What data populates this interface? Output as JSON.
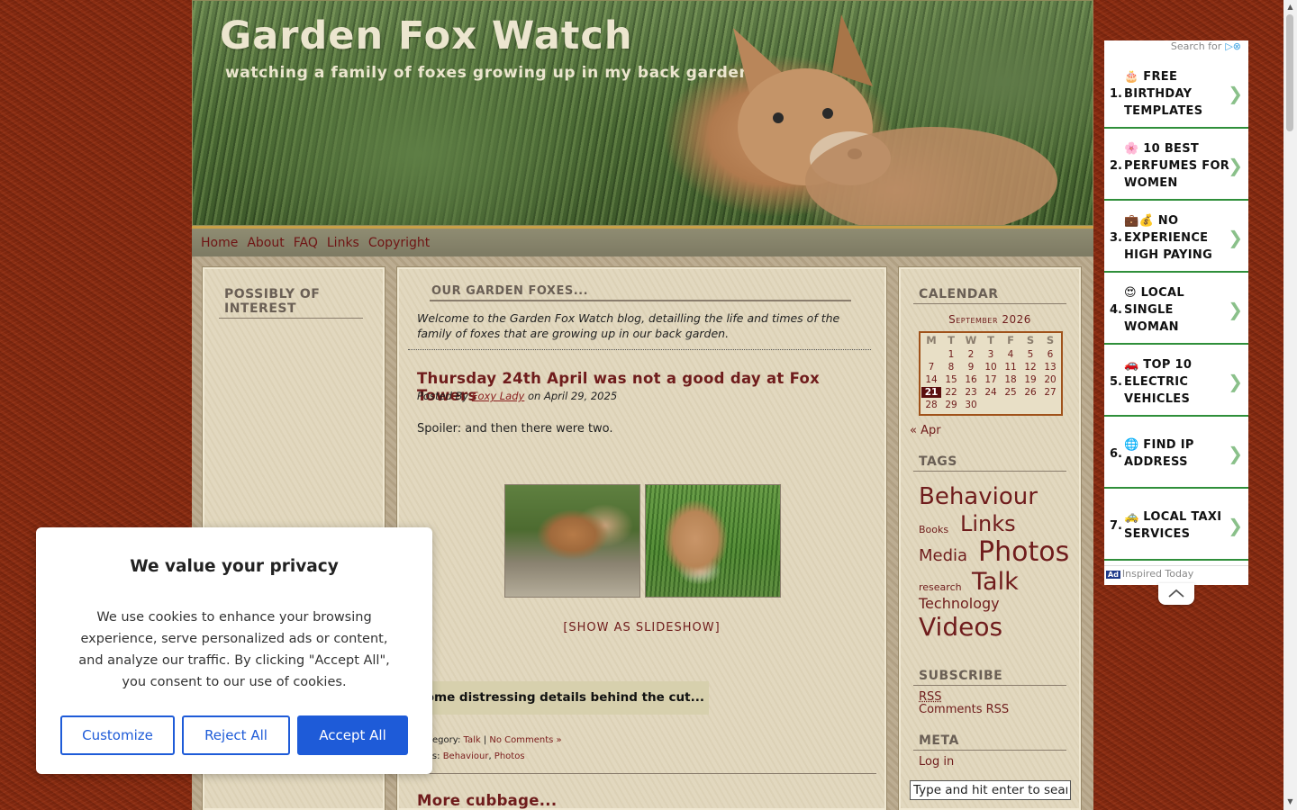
{
  "site": {
    "title": "Garden Fox Watch",
    "description": "watching a family of foxes growing up in my back garden."
  },
  "nav": [
    "Home",
    "About",
    "FAQ",
    "Links",
    "Copyright"
  ],
  "left_sidebar": {
    "title": "POSSIBLY OF INTEREST"
  },
  "intro": {
    "title": "OUR GARDEN FOXES...",
    "text": "Welcome to the Garden Fox Watch blog, detailling the life and times of the family of foxes that are growing up in our back garden."
  },
  "post1": {
    "title": "Thursday 24th April was not a good day at Fox Towers",
    "meta_prefix": "Posted By ",
    "author": "Foxy Lady",
    "meta_suffix": " on April 29, 2025",
    "body": "Spoiler: and then there were two.",
    "slideshow": "[SHOW AS SLIDESHOW]",
    "cut": "Some distressing details behind the cut...",
    "category_label": "Category: ",
    "category": "Talk",
    "sep": " | ",
    "comments": "No Comments »",
    "tags_label": "Tags: ",
    "tag1": "Behaviour",
    "tag_sep": ", ",
    "tag2": "Photos"
  },
  "post2": {
    "title": "More cubbage..."
  },
  "calendar": {
    "title": "CALENDAR",
    "caption": "September 2026",
    "headers": [
      "M",
      "T",
      "W",
      "T",
      "F",
      "S",
      "S"
    ],
    "weeks": [
      [
        "",
        "1",
        "2",
        "3",
        "4",
        "5",
        "6"
      ],
      [
        "7",
        "8",
        "9",
        "10",
        "11",
        "12",
        "13"
      ],
      [
        "14",
        "15",
        "16",
        "17",
        "18",
        "19",
        "20"
      ],
      [
        "21",
        "22",
        "23",
        "24",
        "25",
        "26",
        "27"
      ],
      [
        "28",
        "29",
        "30",
        "",
        "",
        "",
        ""
      ]
    ],
    "today": "21",
    "prev": "« Apr"
  },
  "tags": {
    "title": "TAGS",
    "items": [
      "Behaviour",
      "Books",
      "Links",
      "Media",
      "Photos",
      "research",
      "Talk",
      "Technology",
      "Videos"
    ]
  },
  "subscribe": {
    "title": "SUBSCRIBE",
    "rss": "RSS",
    "comments_rss": "Comments RSS"
  },
  "meta": {
    "title": "META",
    "login": "Log in"
  },
  "search": {
    "placeholder": "Type and hit enter to search"
  },
  "ad": {
    "header": "Search for",
    "items": [
      {
        "num": "1.",
        "text": "🎂 FREE BIRTHDAY TEMPLATES"
      },
      {
        "num": "2.",
        "text": "🌸 10 BEST PERFUMES FOR WOMEN"
      },
      {
        "num": "3.",
        "text": "💼💰 NO EXPERIENCE HIGH PAYING"
      },
      {
        "num": "4.",
        "text": "😍 LOCAL SINGLE WOMAN"
      },
      {
        "num": "5.",
        "text": "🚗 TOP 10 ELECTRIC VEHICLES"
      },
      {
        "num": "6.",
        "text": "🌐 FIND IP ADDRESS"
      },
      {
        "num": "7.",
        "text": "🚕 LOCAL TAXI SERVICES"
      }
    ],
    "badge": "Ad",
    "footer": "Inspired Today"
  },
  "cookie": {
    "title": "We value your privacy",
    "text": "We use cookies to enhance your browsing experience, serve personalized ads or content, and analyze our traffic. By clicking \"Accept All\", you consent to our use of cookies.",
    "customize": "Customize",
    "reject": "Reject All",
    "accept": "Accept All"
  }
}
